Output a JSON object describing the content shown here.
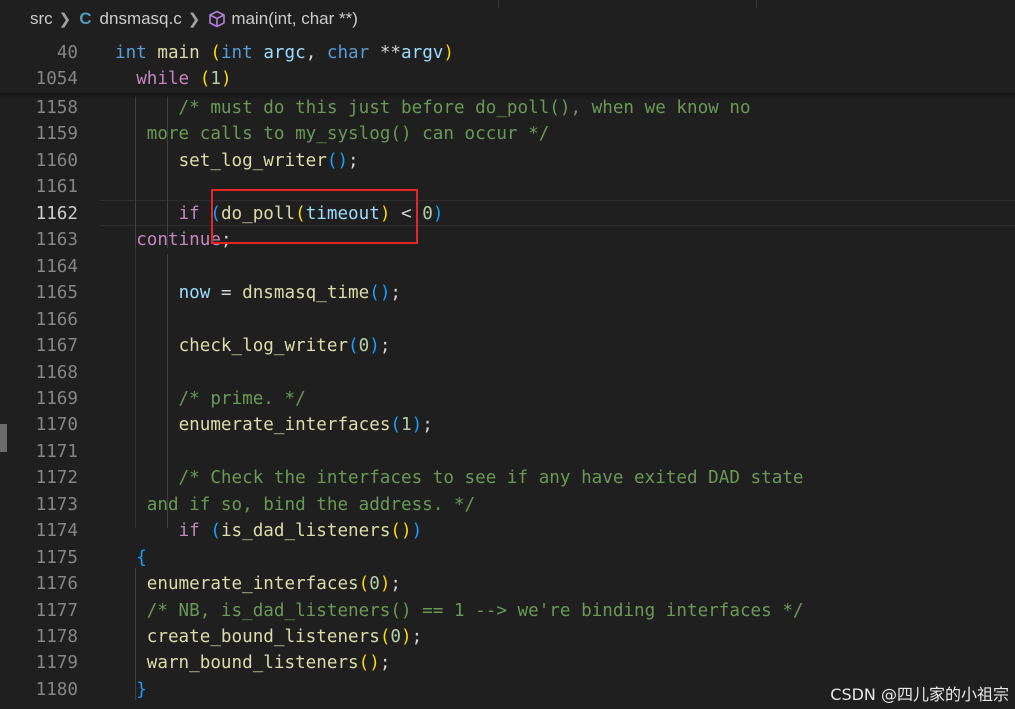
{
  "breadcrumb": {
    "folder": "src",
    "file_icon": "C",
    "file": "dnsmasq.c",
    "symbol": "main(int, char **)"
  },
  "sticky": [
    {
      "ln": "40",
      "tokens": [
        [
          "int",
          "kw"
        ],
        [
          " ",
          ""
        ],
        [
          "main",
          "fn"
        ],
        [
          " ",
          ""
        ],
        [
          "(",
          "p1"
        ],
        [
          "int",
          "kw"
        ],
        [
          " ",
          ""
        ],
        [
          "argc",
          "var"
        ],
        [
          ", ",
          ""
        ],
        [
          "char",
          "kw"
        ],
        [
          " **",
          ""
        ],
        [
          "argv",
          "var"
        ],
        [
          ")",
          "p1"
        ]
      ]
    },
    {
      "ln": "1054",
      "tokens": [
        [
          "  ",
          ""
        ],
        [
          "while",
          "ctl"
        ],
        [
          " ",
          ""
        ],
        [
          "(",
          "p1"
        ],
        [
          "1",
          "num"
        ],
        [
          ")",
          "p1"
        ]
      ]
    }
  ],
  "lines": [
    {
      "ln": "1158",
      "tokens": [
        [
          "      /* must do this just before do_poll(), when we know no",
          "cm"
        ]
      ]
    },
    {
      "ln": "1159",
      "tokens": [
        [
          "   more calls to my_syslog() can occur */",
          "cm"
        ]
      ]
    },
    {
      "ln": "1160",
      "tokens": [
        [
          "      ",
          ""
        ],
        [
          "set_log_writer",
          "fn"
        ],
        [
          "()",
          "p3"
        ],
        [
          ";",
          ""
        ]
      ]
    },
    {
      "ln": "1161",
      "tokens": [
        [
          "",
          ""
        ]
      ]
    },
    {
      "ln": "1162",
      "active": true,
      "tokens": [
        [
          "      ",
          ""
        ],
        [
          "if",
          "ctl"
        ],
        [
          " ",
          ""
        ],
        [
          "(",
          "p3"
        ],
        [
          "do_poll",
          "fn"
        ],
        [
          "(",
          "p1"
        ],
        [
          "timeout",
          "var"
        ],
        [
          ")",
          "p1"
        ],
        [
          " < ",
          ""
        ],
        [
          "0",
          "num"
        ],
        [
          ")",
          "p3"
        ]
      ]
    },
    {
      "ln": "1163",
      "tokens": [
        [
          "  ",
          ""
        ],
        [
          "continue",
          "ctl"
        ],
        [
          ";",
          ""
        ]
      ]
    },
    {
      "ln": "1164",
      "tokens": [
        [
          "",
          ""
        ]
      ]
    },
    {
      "ln": "1165",
      "tokens": [
        [
          "      ",
          ""
        ],
        [
          "now",
          "var"
        ],
        [
          " = ",
          ""
        ],
        [
          "dnsmasq_time",
          "fn"
        ],
        [
          "()",
          "p3"
        ],
        [
          ";",
          ""
        ]
      ]
    },
    {
      "ln": "1166",
      "tokens": [
        [
          "",
          ""
        ]
      ]
    },
    {
      "ln": "1167",
      "tokens": [
        [
          "      ",
          ""
        ],
        [
          "check_log_writer",
          "fn"
        ],
        [
          "(",
          "p3"
        ],
        [
          "0",
          "num"
        ],
        [
          ")",
          "p3"
        ],
        [
          ";",
          ""
        ]
      ]
    },
    {
      "ln": "1168",
      "tokens": [
        [
          "",
          ""
        ]
      ]
    },
    {
      "ln": "1169",
      "tokens": [
        [
          "      /* prime. */",
          "cm"
        ]
      ]
    },
    {
      "ln": "1170",
      "tokens": [
        [
          "      ",
          ""
        ],
        [
          "enumerate_interfaces",
          "fn"
        ],
        [
          "(",
          "p3"
        ],
        [
          "1",
          "num"
        ],
        [
          ")",
          "p3"
        ],
        [
          ";",
          ""
        ]
      ]
    },
    {
      "ln": "1171",
      "tokens": [
        [
          "",
          ""
        ]
      ]
    },
    {
      "ln": "1172",
      "tokens": [
        [
          "      /* Check the interfaces to see if any have exited DAD state",
          "cm"
        ]
      ]
    },
    {
      "ln": "1173",
      "tokens": [
        [
          "   and if so, bind the address. */",
          "cm"
        ]
      ]
    },
    {
      "ln": "1174",
      "tokens": [
        [
          "      ",
          ""
        ],
        [
          "if",
          "ctl"
        ],
        [
          " ",
          ""
        ],
        [
          "(",
          "p3"
        ],
        [
          "is_dad_listeners",
          "fn"
        ],
        [
          "()",
          "p1"
        ],
        [
          ")",
          "p3"
        ]
      ]
    },
    {
      "ln": "1175",
      "tokens": [
        [
          "  ",
          ""
        ],
        [
          "{",
          "p3"
        ]
      ]
    },
    {
      "ln": "1176",
      "tokens": [
        [
          "   ",
          ""
        ],
        [
          "enumerate_interfaces",
          "fn"
        ],
        [
          "(",
          "p1"
        ],
        [
          "0",
          "num"
        ],
        [
          ")",
          "p1"
        ],
        [
          ";",
          ""
        ]
      ]
    },
    {
      "ln": "1177",
      "tokens": [
        [
          "   /* NB, is_dad_listeners() == 1 --> we're binding interfaces */",
          "cm"
        ]
      ]
    },
    {
      "ln": "1178",
      "tokens": [
        [
          "   ",
          ""
        ],
        [
          "create_bound_listeners",
          "fn"
        ],
        [
          "(",
          "p1"
        ],
        [
          "0",
          "num"
        ],
        [
          ")",
          "p1"
        ],
        [
          ";",
          ""
        ]
      ]
    },
    {
      "ln": "1179",
      "tokens": [
        [
          "   ",
          ""
        ],
        [
          "warn_bound_listeners",
          "fn"
        ],
        [
          "()",
          "p1"
        ],
        [
          ";",
          ""
        ]
      ]
    },
    {
      "ln": "1180",
      "tokens": [
        [
          "  ",
          ""
        ],
        [
          "}",
          "p3"
        ]
      ]
    }
  ],
  "watermark": "CSDN @四儿家的小祖宗",
  "colors": {
    "background": "#1f1f1f",
    "keyword": "#569cd6",
    "control": "#c586c0",
    "function": "#dcdcaa",
    "variable": "#9cdcfe",
    "number": "#b5cea8",
    "comment": "#6a9955",
    "highlight_box": "#e5252a"
  }
}
